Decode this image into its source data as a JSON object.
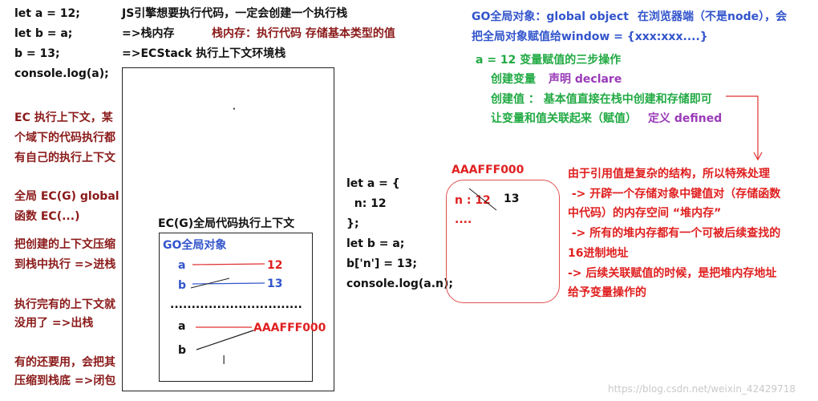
{
  "code_left": [
    "let a = 12;",
    "let b = a;",
    "b = 13;",
    "console.log(a);"
  ],
  "top_notes": {
    "l1": "JS引擎想要执行代码，一定会创建一个执行栈",
    "l2a": "=>栈内存",
    "l2b": "栈内存：执行代码   存储基本类型的值",
    "l3": "=>ECStack  执行上下文环境栈"
  },
  "left_notes": [
    "EC 执行上下文，某",
    "个域下的代码执行都",
    "有自己的执行上下文",
    "全局   EC(G) global",
    "函数   EC(...)",
    "把创建的上下文压缩",
    "到栈中执行 =>进栈",
    "执行完有的上下文就",
    "没用了 =>出栈",
    "有的还要用，会把其",
    "压缩到栈底  =>闭包"
  ],
  "ecg": {
    "title": "EC(G)全局代码执行上下文",
    "go_title": "GO全局对象",
    "var_a": "a",
    "val_a": "12",
    "var_b": "b",
    "val_b": "13",
    "dots": "...............................",
    "var_a2": "a",
    "val_a2": "AAAFFF000",
    "var_b2": "b",
    "cursor": "I"
  },
  "code_mid": [
    "let a = {",
    "  n: 12",
    "};",
    "let b = a;",
    "b['n'] = 13;",
    "console.log(a.n);"
  ],
  "heap": {
    "addr": "AAAFFF000",
    "entry_key": "n : 12",
    "entry_new": "13",
    "more": "...."
  },
  "go_notes": {
    "l1a": "GO全局对象：global object",
    "l1b": "在浏览器端（不是node），会",
    "l2": "把全局对象赋值给window = {xxx:xxx....}"
  },
  "steps": {
    "title": "a = 12  变量赋值的三步操作",
    "s1a": "创建变量",
    "s1b": "声明 declare",
    "s2": "创建值 ： 基本值直接在栈中创建和存储即可",
    "s3a": "让变量和值关联起来（赋值）",
    "s3b": "定义 defined"
  },
  "ref_notes": [
    "由于引用值是复杂的结构，所以特殊处理",
    " -> 开辟一个存储对象中键值对（存储函数",
    "中代码）的内存空间   “堆内存”",
    " -> 所有的堆内存都有一个可被后续查找的",
    "16进制地址",
    "-> 后续关联赋值的时候，是把堆内存地址",
    "给予变量操作的"
  ],
  "watermark": "https://blog.csdn.net/weixin_42429718"
}
